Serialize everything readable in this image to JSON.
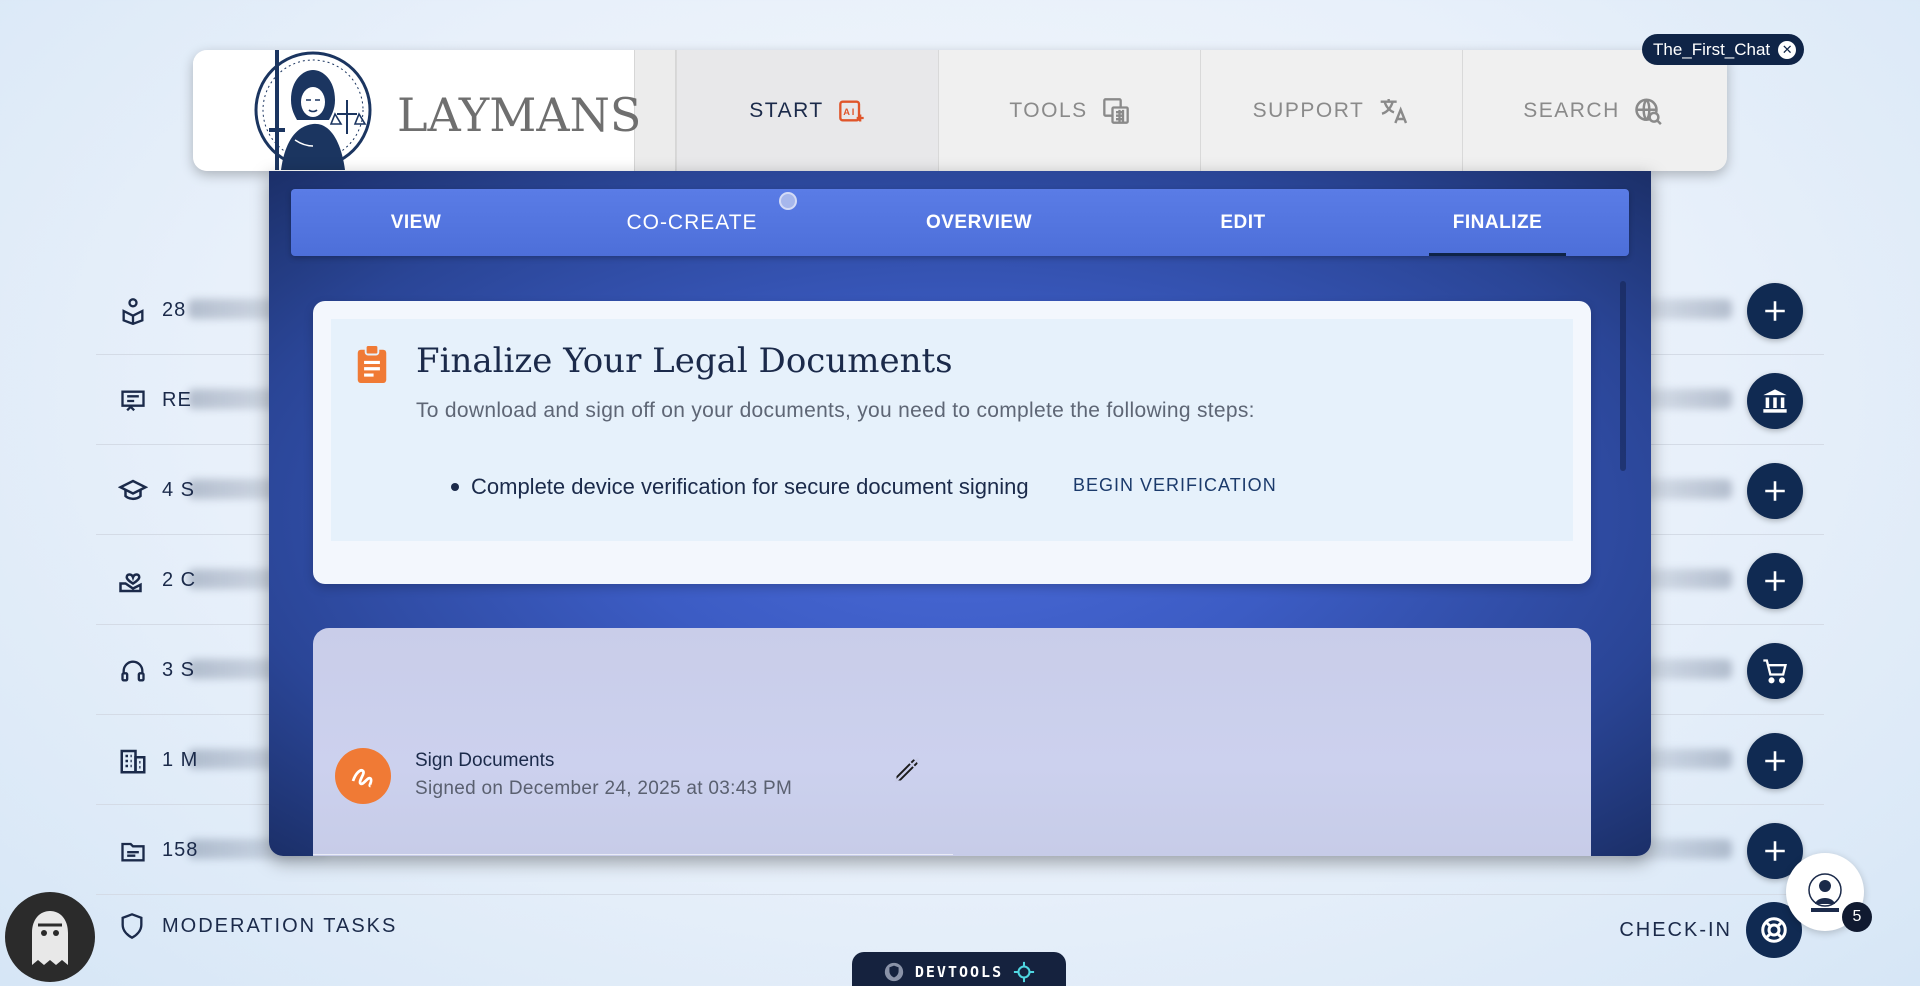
{
  "chat_tab": {
    "label": "The_First_Chat"
  },
  "logo": {
    "text": "LAYMANS"
  },
  "nav": {
    "tabs": [
      {
        "label": "START",
        "icon": "ai-sparkle-icon",
        "active": true
      },
      {
        "label": "TOOLS",
        "icon": "calculator-icon",
        "active": false
      },
      {
        "label": "SUPPORT",
        "icon": "translate-icon",
        "active": false
      },
      {
        "label": "SEARCH",
        "icon": "search-globe-icon",
        "active": false
      }
    ]
  },
  "subtabs": [
    {
      "label": "VIEW"
    },
    {
      "label": "CO-CREATE"
    },
    {
      "label": "OVERVIEW"
    },
    {
      "label": "EDIT"
    },
    {
      "label": "FINALIZE",
      "active": true
    }
  ],
  "finalize": {
    "title": "Finalize Your Legal Documents",
    "subtitle": "To download and sign off on your documents, you need to complete the following steps:",
    "steps": [
      {
        "text": "Complete device verification for secure document signing",
        "action": "BEGIN VERIFICATION"
      }
    ]
  },
  "sign": {
    "title": "Sign Documents",
    "date": "Signed on December 24, 2025 at 03:43 PM"
  },
  "background_rows": [
    {
      "prefix": "28",
      "icon": "user-package-icon",
      "action_icon": "plus-icon"
    },
    {
      "prefix": "RE",
      "icon": "certificate-icon",
      "action_icon": "bank-icon"
    },
    {
      "prefix": "4 S",
      "icon": "graduation-cap-icon",
      "action_icon": "plus-icon"
    },
    {
      "prefix": "2 C",
      "icon": "hand-heart-icon",
      "action_icon": "plus-icon"
    },
    {
      "prefix": "3 S",
      "icon": "headset-icon",
      "action_icon": "cart-icon"
    },
    {
      "prefix": "1 M",
      "icon": "building-icon",
      "action_icon": "plus-icon"
    },
    {
      "prefix": "158",
      "icon": "folder-icon",
      "action_icon": "plus-icon"
    }
  ],
  "bottom": {
    "moderation_label": "MODERATION TASKS",
    "checkin_label": "CHECK-IN",
    "notification_count": "5",
    "devtools_label": "DEVTOOLS"
  },
  "colors": {
    "navy": "#102a52",
    "accent_orange": "#f07a35",
    "panel_blue": "#3c5cc4"
  }
}
